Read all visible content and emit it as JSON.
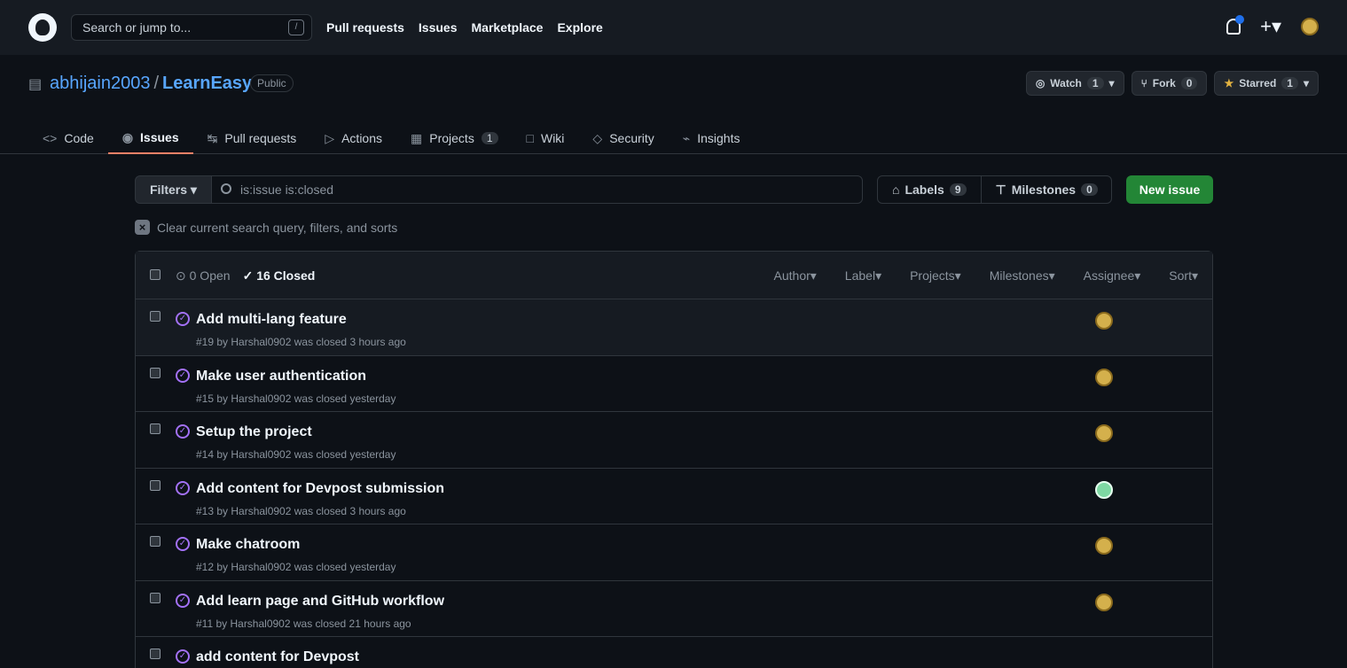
{
  "header": {
    "search_placeholder": "Search or jump to...",
    "shortcut": "/",
    "nav": [
      "Pull requests",
      "Issues",
      "Marketplace",
      "Explore"
    ],
    "plus": "+",
    "caret": "▾"
  },
  "repo": {
    "owner": "abhijain2003",
    "name": "LearnEasy",
    "visibility": "Public",
    "watch_label": "Watch",
    "watch_count": "1",
    "fork_label": "Fork",
    "fork_count": "0",
    "star_label": "Starred",
    "star_count": "1"
  },
  "tabs": [
    {
      "label": "Code",
      "icon": "<>"
    },
    {
      "label": "Issues",
      "icon": "◉"
    },
    {
      "label": "Pull requests",
      "icon": "↹"
    },
    {
      "label": "Actions",
      "icon": "▷"
    },
    {
      "label": "Projects",
      "icon": "▦",
      "count": "1"
    },
    {
      "label": "Wiki",
      "icon": "□"
    },
    {
      "label": "Security",
      "icon": "◇"
    },
    {
      "label": "Insights",
      "icon": "⌁"
    }
  ],
  "filters": {
    "label": "Filters",
    "query": "is:issue is:closed",
    "labels": "Labels",
    "labels_count": "9",
    "milestones": "Milestones",
    "milestones_count": "0",
    "new_issue": "New issue",
    "clear": "Clear current search query, filters, and sorts"
  },
  "list": {
    "open": "0 Open",
    "closed": "16 Closed",
    "sort_labels": [
      "Author",
      "Label",
      "Projects",
      "Milestones",
      "Assignee",
      "Sort"
    ]
  },
  "issues": [
    {
      "title": "Add multi-lang feature",
      "meta": "#19 by Harshal0902 was closed 3 hours ago"
    },
    {
      "title": "Make user authentication",
      "meta": "#15 by Harshal0902 was closed yesterday"
    },
    {
      "title": "Setup the project",
      "meta": "#14 by Harshal0902 was closed yesterday"
    },
    {
      "title": "Add content for Devpost submission",
      "meta": "#13 by Harshal0902 was closed 3 hours ago"
    },
    {
      "title": "Make chatroom",
      "meta": "#12 by Harshal0902 was closed yesterday"
    },
    {
      "title": "Add learn page and GitHub workflow",
      "meta": "#11 by Harshal0902 was closed 21 hours ago"
    },
    {
      "title": "add content for Devpost",
      "meta": ""
    }
  ],
  "colors": {
    "accent": "#58a6ff",
    "new_issue": "#238636",
    "closed_icon": "#a371f7"
  }
}
